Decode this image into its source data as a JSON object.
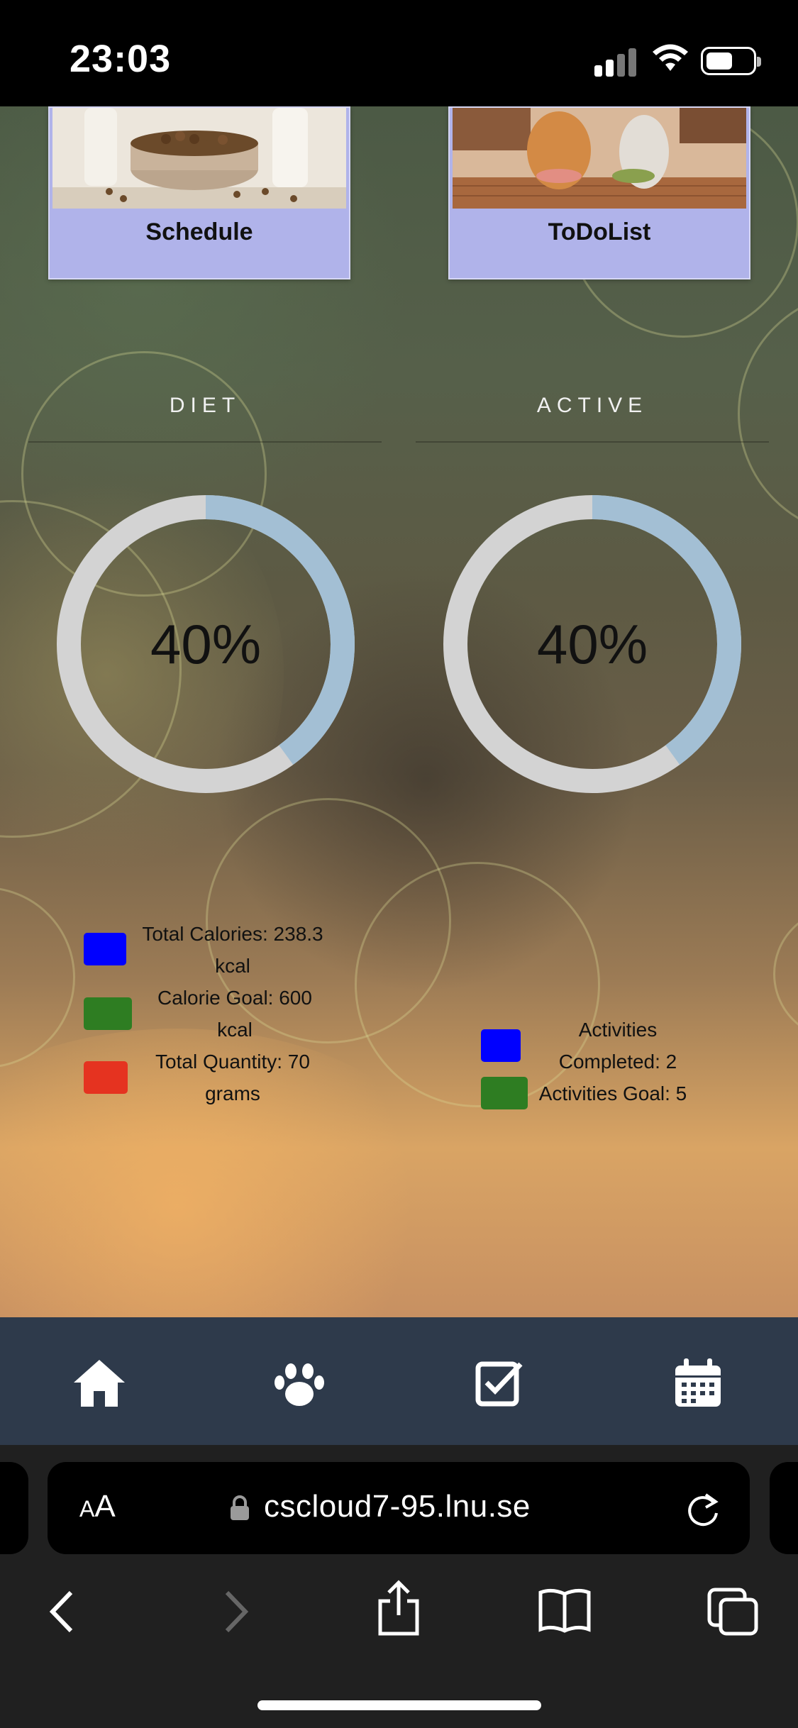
{
  "status_bar": {
    "time": "23:03"
  },
  "cards": [
    {
      "label": "Schedule"
    },
    {
      "label": "ToDoList"
    }
  ],
  "sections": {
    "diet": {
      "title": "DIET",
      "progress_text": "40%",
      "progress": 0.4,
      "legend": [
        {
          "text_line1": "Total Calories: 238.3",
          "text_line2": "kcal",
          "color": "#0000ff"
        },
        {
          "text_line1": "Calorie Goal: 600",
          "text_line2": "kcal",
          "color": "#2e7d22"
        },
        {
          "text_line1": "Total Quantity: 70",
          "text_line2": "grams",
          "color": "#e53320"
        }
      ]
    },
    "active": {
      "title": "ACTIVE",
      "progress_text": "40%",
      "progress": 0.4,
      "legend": [
        {
          "text_line1": "Activities",
          "text_line2": "Completed: 2",
          "color": "#0000ff"
        },
        {
          "text_line1": "Activities Goal: 5",
          "color": "#2e7d22"
        }
      ]
    }
  },
  "gauge_colors": {
    "track": "#d3d3d3",
    "fill": "#a3bfd4"
  },
  "app_nav": [
    {
      "icon": "home-icon"
    },
    {
      "icon": "paw-icon"
    },
    {
      "icon": "checkbox-icon"
    },
    {
      "icon": "calendar-icon"
    }
  ],
  "browser": {
    "text_size_label": "AA",
    "url": "cscloud7-95.lnu.se"
  }
}
